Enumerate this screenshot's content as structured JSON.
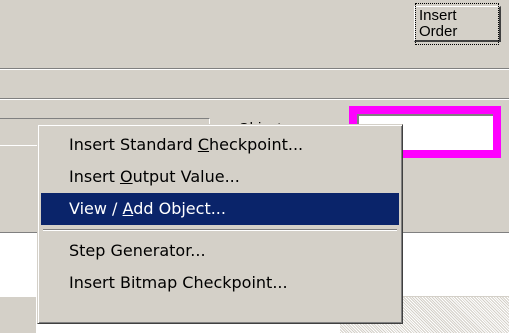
{
  "toolbar": {
    "insert_order_label": "Insert Order"
  },
  "form": {
    "object_label": "Object: "
  },
  "context_menu": {
    "items": [
      {
        "before": "Insert Standard ",
        "mnemonic": "C",
        "after": "heckpoint..."
      },
      {
        "before": "Insert ",
        "mnemonic": "O",
        "after": "utput Value..."
      },
      {
        "before": "View / ",
        "mnemonic": "A",
        "after": "dd Object..."
      },
      {
        "before": "Step Generator...",
        "mnemonic": "",
        "after": ""
      },
      {
        "before": "Insert Bitmap Checkpoint...",
        "mnemonic": "",
        "after": ""
      }
    ],
    "selected_index": 2
  },
  "colors": {
    "face": "#d4d0c8",
    "highlight": "#0a246a",
    "magenta": "#ff00ff"
  }
}
